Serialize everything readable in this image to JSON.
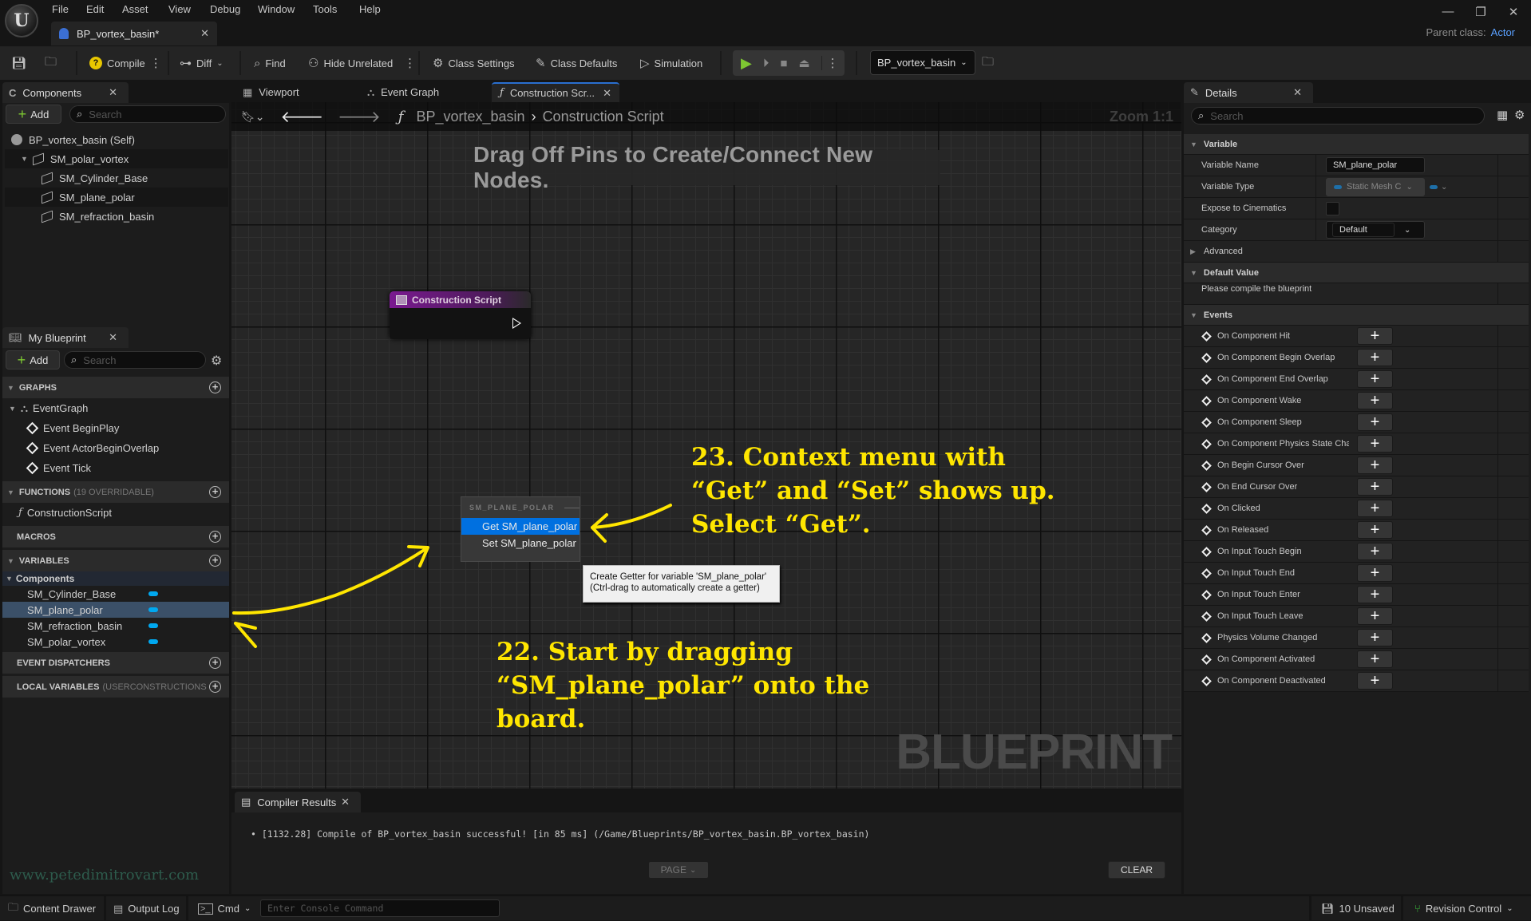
{
  "menu": [
    "File",
    "Edit",
    "Asset",
    "View",
    "Debug",
    "Window",
    "Tools",
    "Help"
  ],
  "document_tab": "BP_vortex_basin*",
  "window": {
    "minimize": "—",
    "restore": "❐",
    "close": "✕"
  },
  "parent_class": {
    "label": "Parent class:",
    "value": "Actor"
  },
  "toolbar": {
    "compile": "Compile",
    "diff": "Diff",
    "find": "Find",
    "hide_unrelated": "Hide Unrelated",
    "class_settings": "Class Settings",
    "class_defaults": "Class Defaults",
    "simulation": "Simulation",
    "debug_object": "BP_vortex_basin"
  },
  "components": {
    "tab": "Components",
    "add": "Add",
    "search_placeholder": "Search",
    "tree": [
      {
        "label": "BP_vortex_basin (Self)",
        "level": 0
      },
      {
        "label": "SM_polar_vortex",
        "level": 1
      },
      {
        "label": "SM_Cylinder_Base",
        "level": 2
      },
      {
        "label": "SM_plane_polar",
        "level": 2
      },
      {
        "label": "SM_refraction_basin",
        "level": 2
      }
    ]
  },
  "my_blueprint": {
    "tab": "My Blueprint",
    "add": "Add",
    "search_placeholder": "Search",
    "graphs": {
      "header": "GRAPHS",
      "items": [
        "EventGraph",
        "Event BeginPlay",
        "Event ActorBeginOverlap",
        "Event Tick"
      ]
    },
    "functions": {
      "header": "FUNCTIONS",
      "note": "(19 OVERRIDABLE)",
      "items": [
        "ConstructionScript"
      ]
    },
    "macros": {
      "header": "MACROS"
    },
    "variables": {
      "header": "VARIABLES",
      "category": "Components",
      "items": [
        "SM_Cylinder_Base",
        "SM_plane_polar",
        "SM_refraction_basin",
        "SM_polar_vortex"
      ],
      "selected": "SM_plane_polar",
      "pin_color": "#00a8f0"
    },
    "event_dispatchers": {
      "header": "EVENT DISPATCHERS"
    },
    "local_variables": {
      "header": "LOCAL VARIABLES",
      "note": "(USERCONSTRUCTIONSCRIPT)"
    }
  },
  "graph_tabs": [
    "Viewport",
    "Event Graph",
    "Construction Scr..."
  ],
  "graph": {
    "breadcrumb": [
      "BP_vortex_basin",
      "Construction Script"
    ],
    "zoom": "Zoom 1:1",
    "banner": "Drag Off Pins to Create/Connect New Nodes.",
    "node_title": "Construction Script",
    "context_menu": {
      "header": "SM_PLANE_POLAR",
      "items": [
        "Get SM_plane_polar",
        "Set SM_plane_polar"
      ],
      "highlighted": 0
    },
    "tooltip": [
      "Create Getter for variable 'SM_plane_polar'",
      "(Ctrl-drag to automatically create a getter)"
    ],
    "watermark": "BLUEPRINT"
  },
  "annotations": {
    "step22": [
      "22. Start by dragging",
      "“SM_plane_polar” onto the",
      "board."
    ],
    "step23": [
      "23. Context menu with",
      "“Get” and “Set” shows up.",
      "Select “Get”."
    ],
    "color": "#ffe600"
  },
  "compiler": {
    "tab": "Compiler Results",
    "message": "[1132.28] Compile of BP_vortex_basin successful! [in 85 ms] (/Game/Blueprints/BP_vortex_basin.BP_vortex_basin)",
    "page": "PAGE",
    "clear": "CLEAR"
  },
  "website": "www.petedimitrovart.com",
  "details": {
    "tab": "Details",
    "search_placeholder": "Search",
    "variable": {
      "header": "Variable",
      "rows": [
        {
          "label": "Variable Name",
          "value": "SM_plane_polar"
        },
        {
          "label": "Variable Type",
          "value": "Static Mesh C"
        },
        {
          "label": "Expose to Cinematics",
          "value": false
        },
        {
          "label": "Category",
          "value": "Default"
        }
      ]
    },
    "advanced": "Advanced",
    "default_value": {
      "header": "Default Value",
      "text": "Please compile the blueprint"
    },
    "events": {
      "header": "Events",
      "items": [
        "On Component Hit",
        "On Component Begin Overlap",
        "On Component End Overlap",
        "On Component Wake",
        "On Component Sleep",
        "On Component Physics State Chan",
        "On Begin Cursor Over",
        "On End Cursor Over",
        "On Clicked",
        "On Released",
        "On Input Touch Begin",
        "On Input Touch End",
        "On Input Touch Enter",
        "On Input Touch Leave",
        "Physics Volume Changed",
        "On Component Activated",
        "On Component Deactivated"
      ]
    }
  },
  "statusbar": {
    "content_drawer": "Content Drawer",
    "output_log": "Output Log",
    "cmd": "Cmd",
    "console_placeholder": "Enter Console Command",
    "unsaved": "10 Unsaved",
    "revision_control": "Revision Control"
  }
}
